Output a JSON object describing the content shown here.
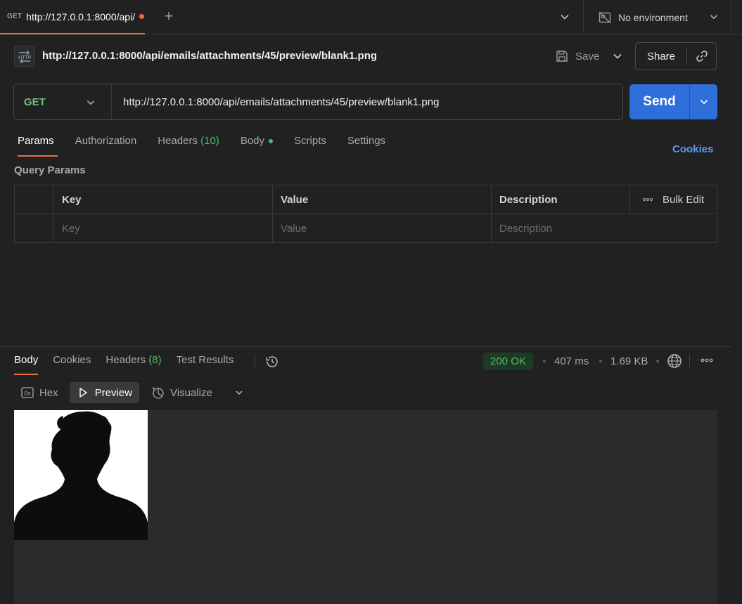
{
  "tab": {
    "method": "GET",
    "title": "http://127.0.0.1:8000/api/emails/attachments/45/preview/blank1.png",
    "plus": "+"
  },
  "environment": {
    "label": "No environment"
  },
  "request": {
    "title": "http://127.0.0.1:8000/api/emails/attachments/45/preview/blank1.png",
    "save_label": "Save",
    "share_label": "Share",
    "method": "GET",
    "url": "http://127.0.0.1:8000/api/emails/attachments/45/preview/blank1.png",
    "send_label": "Send"
  },
  "request_tabs": [
    {
      "label": "Params"
    },
    {
      "label": "Authorization"
    },
    {
      "label": "Headers",
      "count": "(10)"
    },
    {
      "label": "Body"
    },
    {
      "label": "Scripts"
    },
    {
      "label": "Settings"
    }
  ],
  "cookies_link": "Cookies",
  "query_params": {
    "title": "Query Params",
    "headers": {
      "key": "Key",
      "value": "Value",
      "description": "Description",
      "bulk_edit": "Bulk Edit"
    },
    "placeholders": {
      "key": "Key",
      "value": "Value",
      "description": "Description"
    }
  },
  "response": {
    "tabs": [
      {
        "label": "Body"
      },
      {
        "label": "Cookies"
      },
      {
        "label": "Headers",
        "count": "(8)"
      },
      {
        "label": "Test Results"
      }
    ],
    "status": "200 OK",
    "time": "407 ms",
    "size": "1.69 KB",
    "views": {
      "hex": "Hex",
      "preview": "Preview",
      "visualize": "Visualize"
    }
  },
  "colors": {
    "accent_orange": "#f26b3a",
    "send_blue": "#2e6fdc",
    "success_green": "#4dbb6a",
    "link_blue": "#5b9cf0",
    "background": "#212121"
  }
}
